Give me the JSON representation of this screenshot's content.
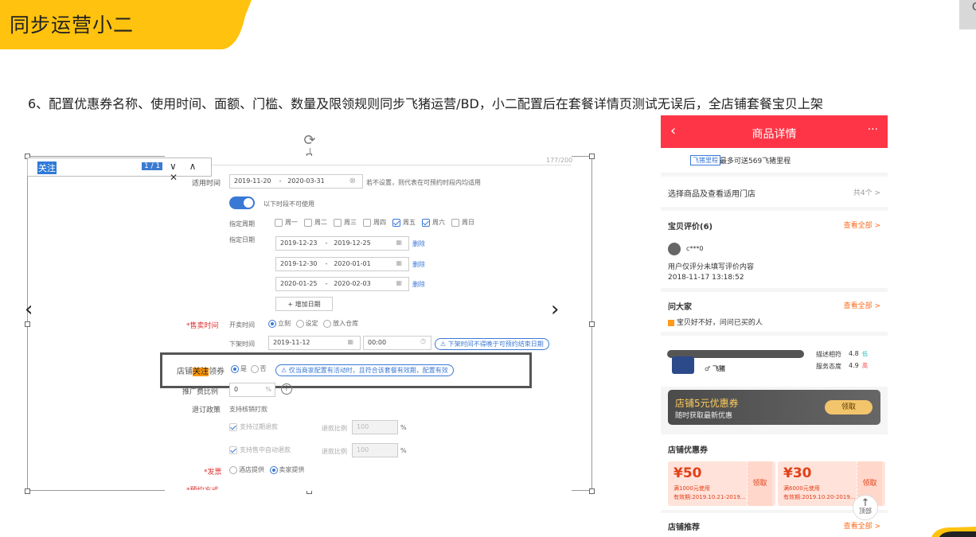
{
  "header": {
    "title": "同步运营小二",
    "accent_color": "#ffc20e",
    "corner_char": "C"
  },
  "step_text": "6、配置优惠券名称、使用时间、面额、门槛、数量及限领规则同步飞猪运营/BD，小二配置后在套餐详情页测试无误后，全店铺套餐宝贝上架",
  "find_bar": {
    "query": "关注",
    "count": "1 / 1",
    "nav": "∨ ∧ ✕"
  },
  "form": {
    "counter": "177/200",
    "use_time_label": "适用时间",
    "use_time_start": "2019-11-20",
    "use_time_end": "2020-03-31",
    "use_time_hint": "若不设置，则代表在可预约时段内均适用",
    "unavailable_label": "以下时段不可使用",
    "week_label": "指定周期",
    "weekdays": [
      {
        "label": "周一",
        "checked": false
      },
      {
        "label": "周二",
        "checked": false
      },
      {
        "label": "周三",
        "checked": false
      },
      {
        "label": "周四",
        "checked": false
      },
      {
        "label": "周五",
        "checked": true
      },
      {
        "label": "周六",
        "checked": true
      },
      {
        "label": "周日",
        "checked": false
      }
    ],
    "date_label": "指定日期",
    "date_ranges": [
      {
        "start": "2019-12-23",
        "end": "2019-12-25"
      },
      {
        "start": "2019-12-30",
        "end": "2020-01-01"
      },
      {
        "start": "2020-01-25",
        "end": "2020-02-03"
      }
    ],
    "delete_label": "删除",
    "add_date_label": "+ 增加日期",
    "sale_time_label": "*售卖时间",
    "sale_start_label": "开卖时间",
    "sale_options": [
      "立刻",
      "设定",
      "放入仓库"
    ],
    "offline_label": "下架时间",
    "offline_date": "2019-11-12",
    "offline_time": "00:00",
    "offline_warn": "下架时间不得晚于可预约结束日期",
    "follow_label_pre": "店铺",
    "follow_label_hl": "关注",
    "follow_label_post": "领券",
    "yes_label": "是",
    "no_label": "否",
    "follow_warn": "仅当商家配置有活动时，且符合该套餐有效期，配置有效",
    "ratio_label": "推广费比例",
    "ratio_value": "0",
    "ratio_unit": "%",
    "refund_label": "退订政策",
    "refund_value": "支持核销打款",
    "refund_expired": "支持过期退款",
    "refund_auto": "支持售中自动退款",
    "refund_ratio_label": "退款比例",
    "refund_ratio_value": "100",
    "invoice_label": "*发票",
    "invoice_options": [
      "酒店提供",
      "卖家提供"
    ],
    "booking_label": "*预约方式"
  },
  "phone": {
    "title": "商品详情",
    "mileage_tag": "飞猪里程",
    "mileage_text": "最多可送569飞猪里程",
    "select_text": "选择商品及查看适用门店",
    "select_count": "共4个 >",
    "review_title": "宝贝评价(6)",
    "view_all": "查看全部 >",
    "reviewer": "c***0",
    "review_text": "用户仅评分未填写评价内容",
    "review_time": "2018-11-17 13:18:52",
    "ask_title": "问大家",
    "ask_q": "宝贝好不好，问问已买的人",
    "shop_logo": "飞猪",
    "score1_label": "描述相符",
    "score1": "4.8",
    "score1_tag": "低",
    "score2_label": "服务态度",
    "score2": "4.9",
    "score2_tag": "高",
    "banner_title": "店铺5元优惠券",
    "banner_sub": "随时获取最新优惠",
    "banner_btn": "领取",
    "coupon_section": "店铺优惠券",
    "coupons": [
      {
        "amount": "¥50",
        "cond": "满1000元使用",
        "date": "有效期:2019.10.21-2019...",
        "get": "领取"
      },
      {
        "amount": "¥30",
        "cond": "满6000元使用",
        "date": "有效期:2019.10.20-2019...",
        "get": "领取"
      }
    ],
    "recommend_title": "店铺推荐",
    "top_label": "顶部",
    "accent": "#fd3546"
  }
}
